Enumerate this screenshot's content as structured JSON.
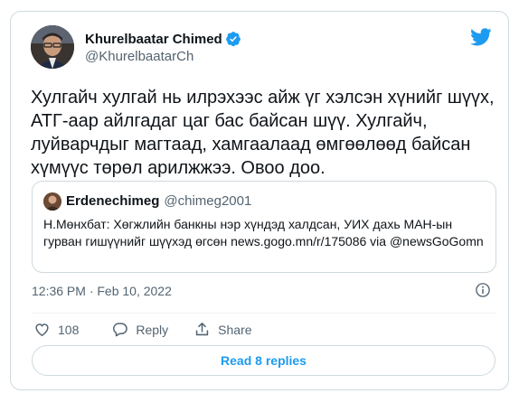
{
  "colors": {
    "accent": "#1d9bf0",
    "muted": "#536471",
    "text": "#0f1419",
    "border": "#cfd9de"
  },
  "author": {
    "name": "Khurelbaatar Chimed",
    "handle": "@KhurelbaatarCh",
    "verified": true,
    "avatar_icon": "profile-photo"
  },
  "tweet": {
    "text": "Хулгайч хулгай нь илрэхээс айж үг хэлсэн хүнийг шүүх, АТГ-аар айлгадаг цаг бас байсан шүү. Хулгайч, луйварчдыг магтаад, хамгаалаад өмгөөлөөд байсан хүмүүс төрөл арилжжээ. Овоо доо."
  },
  "quoted": {
    "name": "Erdenechimeg",
    "handle": "@chimeg2001",
    "text": "Н.Мөнхбат: Хөгжлийн банкны нэр хүндэд халдсан, УИХ дахь МАН-ын гурван гишүүнийг шүүхэд өгсөн news.gogo.mn/r/175086 via @newsGoGomn"
  },
  "meta": {
    "timestamp": "12:36 PM · Feb 10, 2022",
    "info_icon": "info-icon"
  },
  "actions": {
    "like_count": "108",
    "reply_label": "Reply",
    "share_label": "Share"
  },
  "footer": {
    "read_replies_label": "Read 8 replies"
  }
}
